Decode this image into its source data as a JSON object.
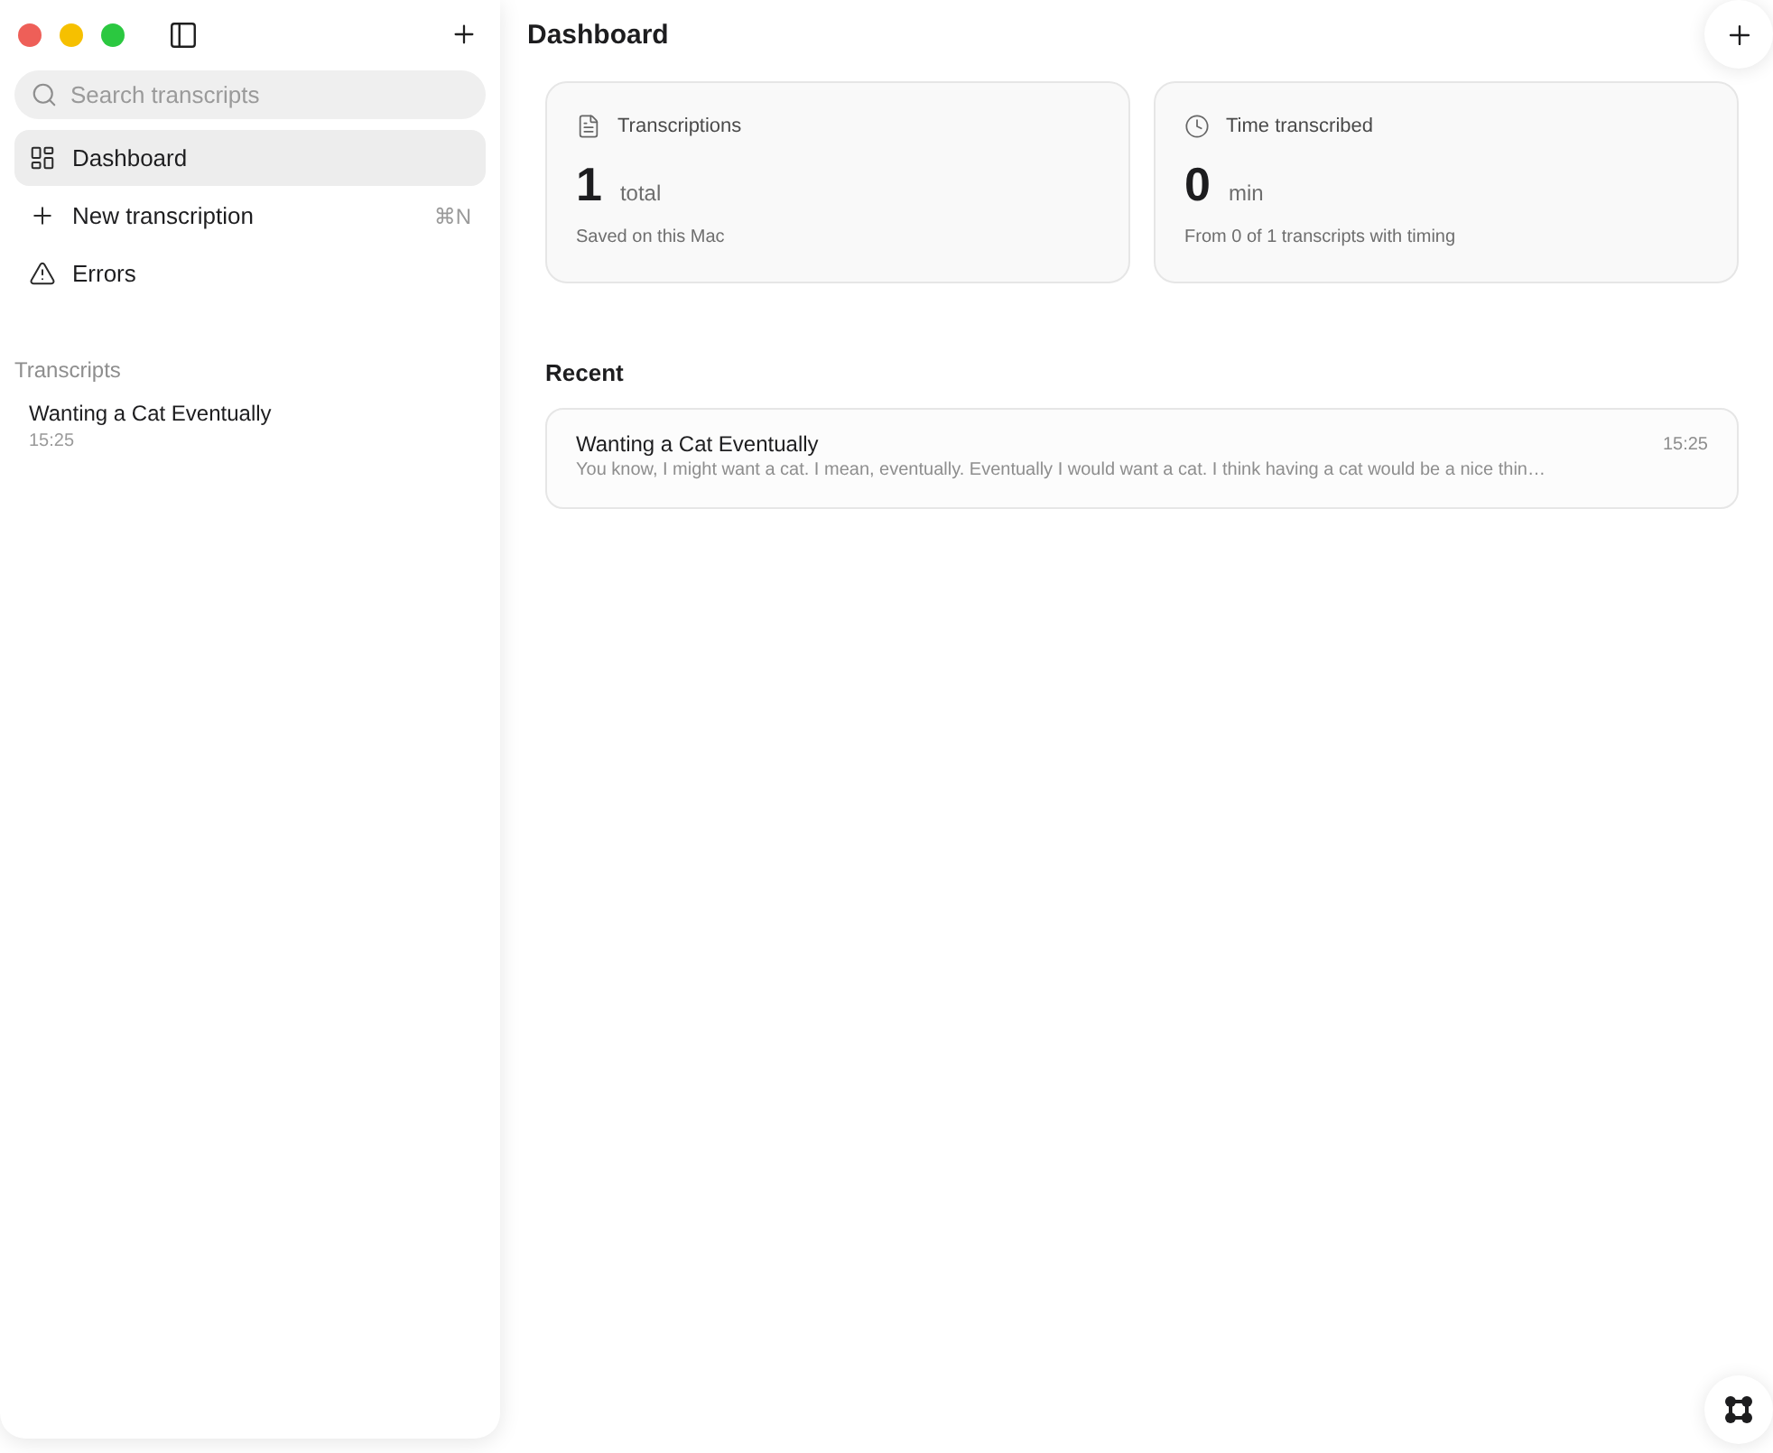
{
  "window_controls": [
    {
      "color": "#ee5f58"
    },
    {
      "color": "#f6c000"
    },
    {
      "color": "#2bc840"
    }
  ],
  "sidebar": {
    "search": {
      "placeholder": "Search transcripts"
    },
    "nav": [
      {
        "kind": "dashboard",
        "label": "Dashboard",
        "selected": true
      },
      {
        "kind": "new",
        "label": "New transcription",
        "shortcut": "⌘N",
        "selected": false
      },
      {
        "kind": "errors",
        "label": "Errors",
        "selected": false
      }
    ],
    "section_title": "Transcripts",
    "transcripts": [
      {
        "title": "Wanting a Cat Eventually",
        "time": "15:25",
        "selected": false
      }
    ]
  },
  "main": {
    "title": "Dashboard",
    "stats": [
      {
        "kind": "document",
        "label": "Transcriptions",
        "value": "1",
        "unit": "total",
        "note": "Saved on this Mac"
      },
      {
        "kind": "clock",
        "label": "Time transcribed",
        "value": "0",
        "unit": "min",
        "note": "From 0 of 1 transcripts with timing"
      }
    ],
    "recent_title": "Recent",
    "recent": [
      {
        "title": "Wanting a Cat Eventually",
        "preview": "You know, I might want a cat. I mean, eventually. Eventually I would want a cat. I think having a cat would be a nice thin…",
        "time": "15:25"
      }
    ]
  }
}
